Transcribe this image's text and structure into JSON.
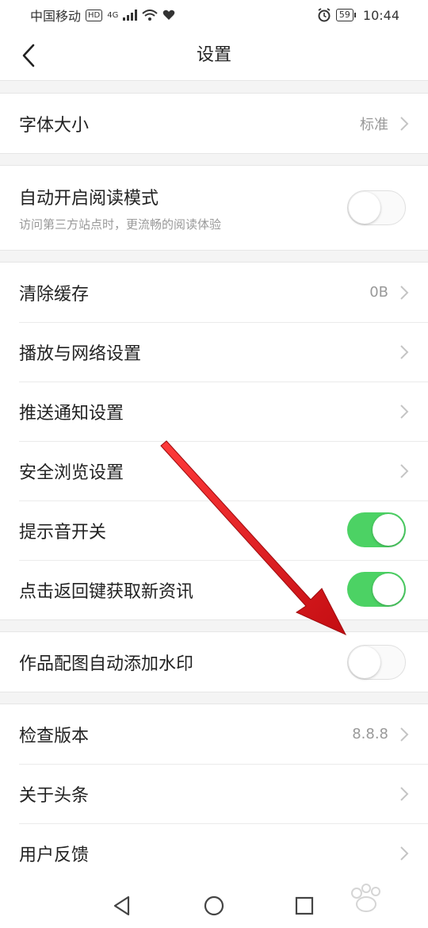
{
  "status_bar": {
    "carrier": "中国移动",
    "hd": "HD",
    "network": "4G",
    "battery": "59",
    "time": "10:44"
  },
  "header": {
    "title": "设置"
  },
  "rows": {
    "font_size": {
      "label": "字体大小",
      "value": "标准"
    },
    "reading_mode": {
      "label": "自动开启阅读模式",
      "subtitle": "访问第三方站点时，更流畅的阅读体验",
      "on": false
    },
    "clear_cache": {
      "label": "清除缓存",
      "value": "0B"
    },
    "playback_network": {
      "label": "播放与网络设置"
    },
    "push_notifications": {
      "label": "推送通知设置"
    },
    "safe_browsing": {
      "label": "安全浏览设置"
    },
    "sound_toggle": {
      "label": "提示音开关",
      "on": true
    },
    "back_refresh": {
      "label": "点击返回键获取新资讯",
      "on": true
    },
    "watermark": {
      "label": "作品配图自动添加水印",
      "on": false
    },
    "check_version": {
      "label": "检查版本",
      "value": "8.8.8"
    },
    "about": {
      "label": "关于头条"
    },
    "feedback": {
      "label": "用户反馈"
    }
  },
  "colors": {
    "toggle_on": "#4cd264",
    "annotation_arrow": "#e8141c"
  },
  "icons": {
    "back": "back-chevron-icon",
    "chevron": "chevron-right-icon",
    "nav_back": "triangle-back-icon",
    "nav_home": "circle-home-icon",
    "nav_recent": "square-recent-icon"
  }
}
